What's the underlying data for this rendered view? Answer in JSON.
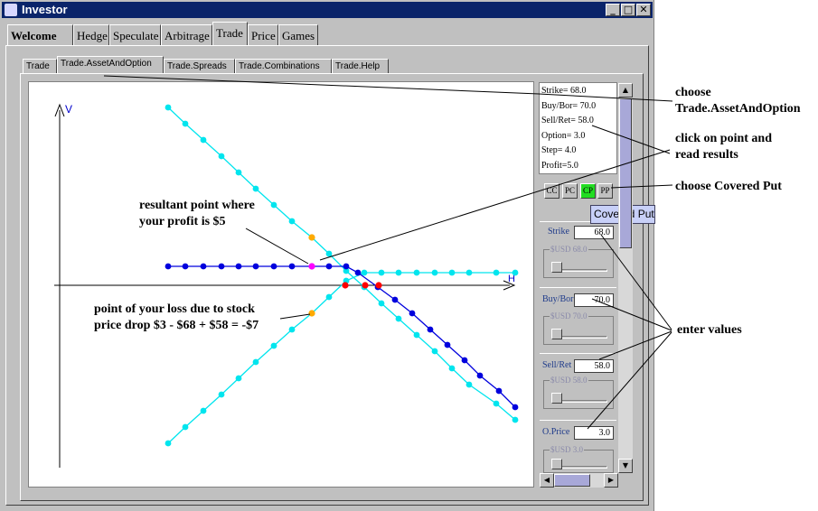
{
  "window": {
    "title": "Investor",
    "controls": [
      "_",
      "□",
      "✕"
    ]
  },
  "main_tabs": [
    {
      "label": "Welcome",
      "active": false
    },
    {
      "label": "Hedge",
      "active": false
    },
    {
      "label": "Speculate",
      "active": false
    },
    {
      "label": "Arbitrage",
      "active": false
    },
    {
      "label": "Trade",
      "active": true
    },
    {
      "label": "Price",
      "active": false
    },
    {
      "label": "Games",
      "active": false
    }
  ],
  "sub_tabs": [
    {
      "label": "Trade",
      "active": false
    },
    {
      "label": "Trade.AssetAndOption",
      "active": true
    },
    {
      "label": "Trade.Spreads",
      "active": false
    },
    {
      "label": "Trade.Combinations",
      "active": false
    },
    {
      "label": "Trade.Help",
      "active": false
    }
  ],
  "readout": [
    "Strike= 68.0",
    "Buy/Bor= 70.0",
    "Sell/Ret= 58.0",
    "Option= 3.0",
    "Step= 4.0",
    "Profit=5.0"
  ],
  "strategy_buttons": [
    {
      "label": "CC",
      "selected": false
    },
    {
      "label": "PC",
      "selected": false
    },
    {
      "label": "CP",
      "selected": true
    },
    {
      "label": "PP",
      "selected": false
    }
  ],
  "tooltip": "Covered Put",
  "inputs": [
    {
      "label": "Strike",
      "value": "68.0",
      "slider_title": "$USD 68.0"
    },
    {
      "label": "Buy/Bor",
      "value": "70.0",
      "slider_title": "$USD 70.0"
    },
    {
      "label": "Sell/Ret",
      "value": "58.0",
      "slider_title": "$USD 58.0"
    },
    {
      "label": "O.Price",
      "value": "3.0",
      "slider_title": "$USD 3.0"
    }
  ],
  "chart_data": {
    "type": "line",
    "xlabel": "H",
    "ylabel": "V",
    "colors": {
      "light": "#00e5ee",
      "dark": "#0000dd",
      "selected": "#ff00ff",
      "loss": "#ffaa00",
      "red": "#ff0000"
    },
    "series": [
      {
        "points": [
          [
            186,
            119
          ],
          [
            205,
            137
          ],
          [
            225,
            155
          ],
          [
            245,
            173
          ],
          [
            264,
            191
          ],
          [
            283,
            209
          ],
          [
            303,
            227
          ],
          [
            323,
            245
          ],
          [
            345,
            263
          ],
          [
            364,
            281
          ],
          [
            383,
            300
          ],
          [
            403,
            318
          ],
          [
            422,
            336
          ],
          [
            441,
            353
          ],
          [
            461,
            371
          ],
          [
            481,
            389
          ],
          [
            500,
            408
          ],
          [
            519,
            426
          ],
          [
            549,
            447
          ],
          [
            570,
            465
          ]
        ],
        "color": "light"
      },
      {
        "points": [
          [
            186,
            491
          ],
          [
            205,
            473
          ],
          [
            225,
            455
          ],
          [
            245,
            437
          ],
          [
            264,
            419
          ],
          [
            283,
            401
          ],
          [
            303,
            383
          ],
          [
            323,
            365
          ],
          [
            345,
            347
          ],
          [
            364,
            329
          ],
          [
            383,
            311
          ],
          [
            403,
            302
          ],
          [
            422,
            302
          ],
          [
            441,
            302
          ],
          [
            461,
            302
          ],
          [
            481,
            302
          ],
          [
            500,
            302
          ],
          [
            519,
            302
          ],
          [
            549,
            302
          ],
          [
            570,
            302
          ]
        ],
        "color": "light"
      },
      {
        "points": [
          [
            186,
            295
          ],
          [
            205,
            295
          ],
          [
            225,
            295
          ],
          [
            245,
            295
          ],
          [
            264,
            295
          ],
          [
            283,
            295
          ],
          [
            303,
            295
          ],
          [
            323,
            295
          ],
          [
            345,
            295
          ],
          [
            364,
            295
          ],
          [
            383,
            295
          ],
          [
            396,
            302
          ],
          [
            418,
            318
          ],
          [
            437,
            332
          ],
          [
            456,
            347
          ],
          [
            476,
            365
          ],
          [
            495,
            382
          ],
          [
            514,
            399
          ],
          [
            531,
            416
          ],
          [
            552,
            433
          ],
          [
            570,
            451
          ]
        ],
        "color": "dark"
      }
    ],
    "highlights": [
      {
        "point": [
          345,
          295
        ],
        "color": "selected"
      },
      {
        "point": [
          345,
          263
        ],
        "color": "loss"
      },
      {
        "point": [
          345,
          347
        ],
        "color": "loss"
      },
      {
        "point": [
          382,
          316
        ],
        "color": "red"
      },
      {
        "point": [
          404,
          316
        ],
        "color": "red"
      },
      {
        "point": [
          419,
          316
        ],
        "color": "red"
      }
    ]
  },
  "annotations": [
    {
      "lines": [
        "choose",
        "Trade.AssetAndOption"
      ]
    },
    {
      "lines": [
        "click on point and",
        "read results"
      ]
    },
    {
      "lines": [
        "choose Covered Put"
      ]
    },
    {
      "lines": [
        "resultant point where",
        "your profit is $5"
      ]
    },
    {
      "lines": [
        "point of your loss due to stock",
        "price drop $3 - $68 + $58 = -$7"
      ]
    },
    {
      "lines": [
        "enter values"
      ]
    }
  ]
}
